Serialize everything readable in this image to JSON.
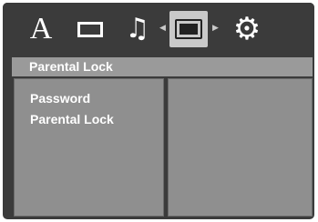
{
  "icons": [
    {
      "name": "language-icon",
      "glyph": "A"
    },
    {
      "name": "display-icon",
      "glyph": ""
    },
    {
      "name": "audio-icon",
      "glyph": "♫"
    },
    {
      "name": "parental-icon",
      "glyph": ""
    },
    {
      "name": "setup-icon",
      "glyph": "⚙"
    }
  ],
  "nav": {
    "left_arrow": "◀",
    "right_arrow": "▶"
  },
  "title": "Parental Lock",
  "menu": {
    "items": [
      {
        "label": "Password"
      },
      {
        "label": "Parental Lock"
      }
    ]
  },
  "colors": {
    "osd_background": "#3b3b3b",
    "title_bar": "#9a9a9a",
    "panel": "#8f8f8f",
    "selected_icon_bg": "#c9c9c9",
    "text": "#ffffff"
  }
}
